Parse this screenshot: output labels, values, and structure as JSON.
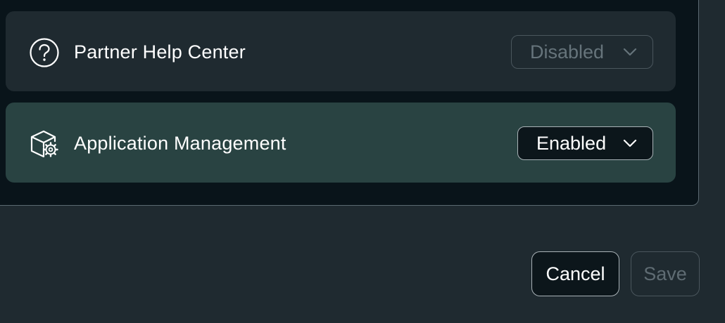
{
  "features": {
    "items": [
      {
        "label": "Partner Help Center",
        "icon": "question-circle-icon",
        "status": "Disabled"
      },
      {
        "label": "Application Management",
        "icon": "box-gear-icon",
        "status": "Enabled"
      }
    ]
  },
  "footer": {
    "cancel_label": "Cancel",
    "save_label": "Save"
  },
  "colors": {
    "background": "#1f2a30",
    "panel": "#09141a",
    "active_row": "#294342",
    "disabled_text": "#66747b"
  }
}
